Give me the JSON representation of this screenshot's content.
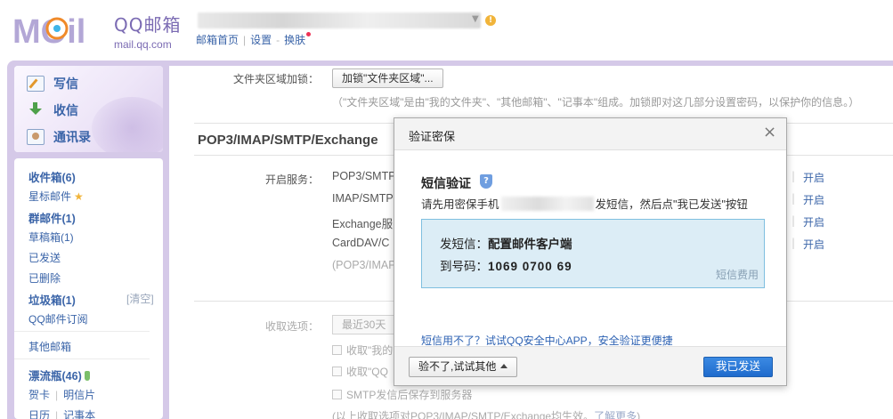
{
  "header": {
    "logo_text": "MOil",
    "brand_cn": "QQ邮箱",
    "brand_domain": "mail.qq.com",
    "nav": [
      "邮箱首页",
      "设置",
      "换肤"
    ]
  },
  "quick_actions": [
    "写信",
    "收信",
    "通讯录"
  ],
  "folders": {
    "inbox": "收件箱(6)",
    "starred": "星标邮件",
    "group": "群邮件(1)",
    "drafts": "草稿箱(1)",
    "sent": "已发送",
    "deleted": "已删除",
    "spam": "垃圾箱(1)",
    "spam_clear": "[清空]",
    "subscriptions": "QQ邮件订阅",
    "other": "其他邮箱",
    "drift_bottle": "漂流瓶(46)",
    "cards": "贺卡",
    "postcards": "明信片",
    "calendar": "日历",
    "notes": "记事本"
  },
  "settings": {
    "folder_lock_label": "文件夹区域加锁：",
    "folder_lock_button": "加锁\"文件夹区域\"...",
    "folder_lock_hint": "（\"文件夹区域\"是由\"我的文件夹\"、\"其他邮箱\"、\"记事本\"组成。加锁即对这几部分设置密码，以保护你的信息。）",
    "section_title": "POP3/IMAP/SMTP/Exchange",
    "open_service_label": "开启服务：",
    "services": [
      "POP3/SMTP",
      "IMAP/SMTP",
      "Exchange服",
      "CardDAV/C",
      "(POP3/IMAP"
    ],
    "open_links": [
      "开启",
      "开启",
      "开启",
      "开启"
    ],
    "receive_label": "收取选项：",
    "receive_select": "最近30天",
    "checks": [
      "收取\"我的",
      "收取\"QQ",
      "SMTP发信后保存到服务器"
    ],
    "foot_note": "(以上收取选项对POP3/IMAP/SMTP/Exchange均生效。",
    "foot_link": "了解更多"
  },
  "modal": {
    "title": "验证密保",
    "close": "×",
    "sms_title": "短信验证",
    "desc_prefix": "请先用密保手机",
    "desc_suffix": "发短信，然后点\"我已发送\"按钮",
    "send_label": "发短信：",
    "send_value": "配置邮件客户端",
    "to_label": "到号码：",
    "to_value": "1069 0700 69",
    "fee_link": "短信费用",
    "alt_link": "短信用不了？试试QQ安全中心APP，安全验证更便捷",
    "alt_button": "验不了,试试其他",
    "confirm_button": "我已发送"
  },
  "colors": {
    "brand_purple": "#7b6bb3",
    "link_blue": "#3a64a8",
    "primary_button": "#2a76d4",
    "sms_box_bg": "#dcedf6"
  }
}
